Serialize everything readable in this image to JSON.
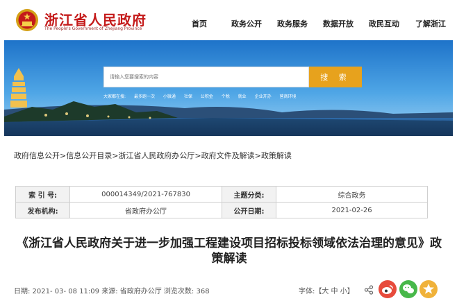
{
  "header": {
    "site_name": "浙江省人民政府",
    "site_name_en": "The People's Government of Zhejiang Province",
    "nav": [
      "首页",
      "政务公开",
      "政务服务",
      "数据开放",
      "政民互动",
      "了解浙江"
    ]
  },
  "search": {
    "placeholder": "请输入您要搜索的内容",
    "button_label": "搜 索",
    "hotwords_label": "大家都在搜:",
    "hotwords": [
      "最多跑一次",
      "小微通",
      "社保",
      "公积金",
      "个税",
      "就业",
      "企业开办",
      "营商环境"
    ]
  },
  "breadcrumb": "政府信息公开>信息公开目录>浙江省人民政府办公厅>政府文件及解读>政策解读",
  "info": {
    "rows": [
      {
        "label1": "索 引 号:",
        "value1": "000014349/2021-767830",
        "label2": "主题分类:",
        "value2": "综合政务"
      },
      {
        "label1": "发布机构:",
        "value1": "省政府办公厅",
        "label2": "公开日期:",
        "value2": "2021-02-26"
      }
    ]
  },
  "article": {
    "title": "《浙江省人民政府关于进一步加强工程建设项目招标投标领域依法治理的意见》政策解读",
    "meta": "日期: 2021- 03- 08 11:09 来源: 省政府办公厅 浏览次数: 368",
    "font_size_label": "字体:【大 中 小】"
  },
  "colors": {
    "brand_red": "#c41a1a",
    "search_orange": "#e7a21d",
    "weibo": "#e74b3c",
    "wechat": "#48b84a",
    "favorite": "#f0b23a"
  }
}
